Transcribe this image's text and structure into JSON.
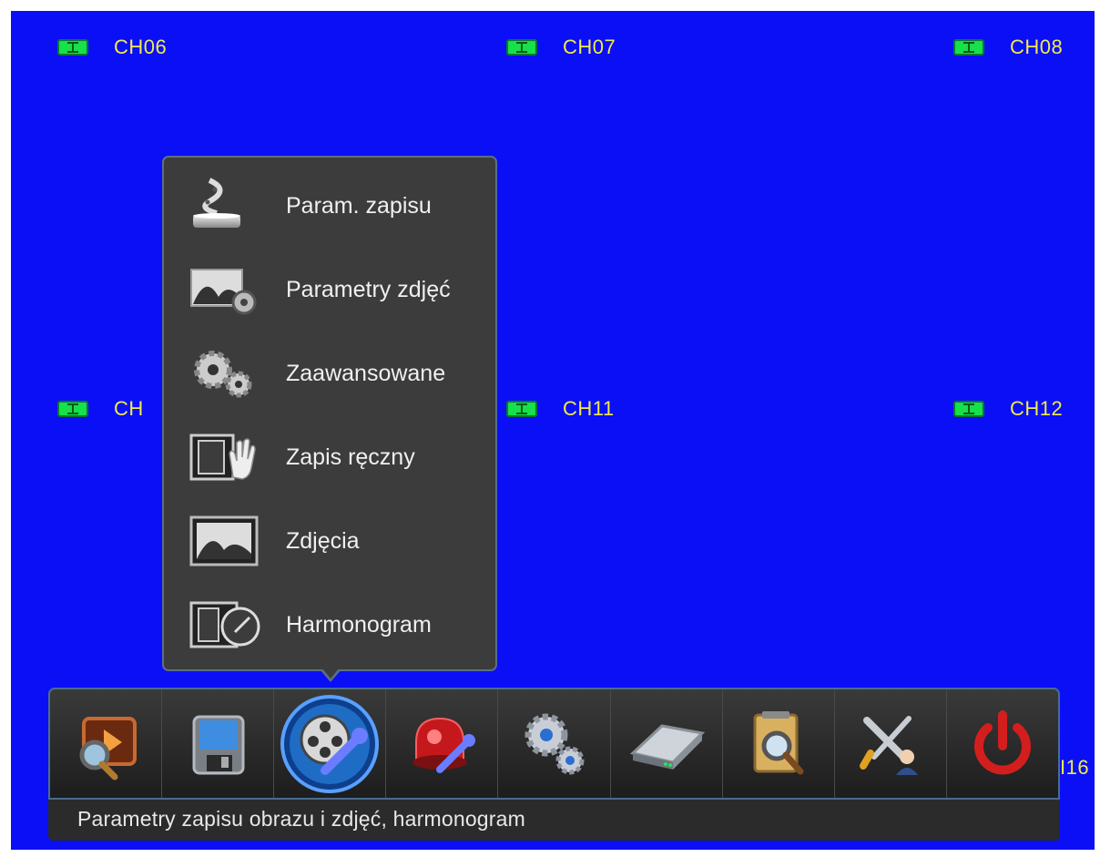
{
  "channels": [
    {
      "label": "CH06"
    },
    {
      "label": "CH07"
    },
    {
      "label": "CH08"
    },
    {
      "label": "CH"
    },
    {
      "label": "CH11"
    },
    {
      "label": "CH12"
    },
    {
      "label": "I16"
    }
  ],
  "submenu": {
    "items": [
      {
        "label": "Param. zapisu",
        "icon": "record-param-icon"
      },
      {
        "label": "Parametry zdjęć",
        "icon": "image-settings-icon"
      },
      {
        "label": "Zaawansowane",
        "icon": "gears-icon"
      },
      {
        "label": "Zapis ręczny",
        "icon": "manual-record-icon"
      },
      {
        "label": "Zdjęcia",
        "icon": "snapshot-icon"
      },
      {
        "label": "Harmonogram",
        "icon": "schedule-icon"
      }
    ]
  },
  "toolbar": {
    "buttons": [
      {
        "name": "playback-search",
        "icon": "playback-search-icon"
      },
      {
        "name": "backup",
        "icon": "floppy-disk-icon"
      },
      {
        "name": "record-settings",
        "icon": "film-reel-wrench-icon",
        "active": true
      },
      {
        "name": "alarm-settings",
        "icon": "alarm-light-wrench-icon"
      },
      {
        "name": "system-settings",
        "icon": "gears-icon"
      },
      {
        "name": "hdd-management",
        "icon": "hard-drive-icon"
      },
      {
        "name": "log-search",
        "icon": "notepad-magnifier-icon"
      },
      {
        "name": "maintenance",
        "icon": "tools-user-icon"
      },
      {
        "name": "shutdown",
        "icon": "power-icon"
      }
    ]
  },
  "status": {
    "text": "Parametry zapisu obrazu i zdjęć, harmonogram"
  },
  "colors": {
    "background": "#0a0ff5",
    "channel_label": "#f2ea4a",
    "rec_indicator": "#16e04a",
    "menu_bg": "#3c3c3c"
  }
}
